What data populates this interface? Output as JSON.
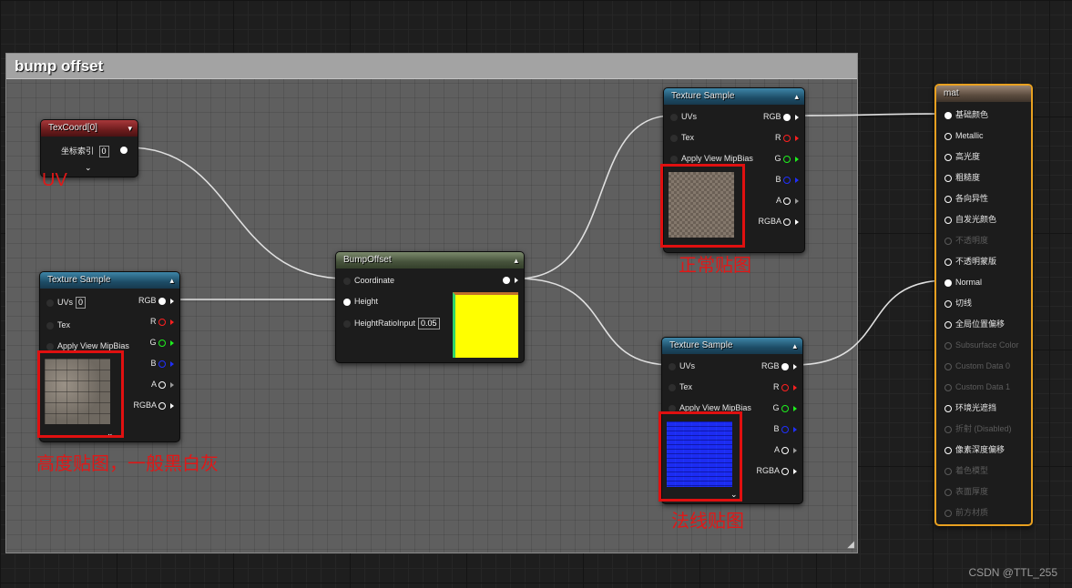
{
  "comment": {
    "title": "bump offset"
  },
  "texcoord_node": {
    "title": "TexCoord[0]",
    "pin_label": "坐标索引",
    "pin_value": "0"
  },
  "texture_height": {
    "title": "Texture Sample",
    "inputs": {
      "uvs": "UVs",
      "uvs_value": "0",
      "tex": "Tex",
      "mip": "Apply View MipBias"
    },
    "outputs": [
      "RGB",
      "R",
      "G",
      "B",
      "A",
      "RGBA"
    ]
  },
  "bump_offset": {
    "title": "BumpOffset",
    "inputs": {
      "coordinate": "Coordinate",
      "height": "Height",
      "ratio": "HeightRatioInput",
      "ratio_value": "0.05"
    }
  },
  "texture_base": {
    "title": "Texture Sample",
    "inputs": {
      "uvs": "UVs",
      "tex": "Tex",
      "mip": "Apply View MipBias"
    },
    "outputs": [
      "RGB",
      "R",
      "G",
      "B",
      "A",
      "RGBA"
    ]
  },
  "texture_normal": {
    "title": "Texture Sample",
    "inputs": {
      "uvs": "UVs",
      "tex": "Tex",
      "mip": "Apply View MipBias"
    },
    "outputs": [
      "RGB",
      "R",
      "G",
      "B",
      "A",
      "RGBA"
    ]
  },
  "material": {
    "title": "mat",
    "pins": [
      {
        "label": "基础颜色",
        "state": "connected"
      },
      {
        "label": "Metallic",
        "state": "open"
      },
      {
        "label": "高光度",
        "state": "open"
      },
      {
        "label": "粗糙度",
        "state": "open"
      },
      {
        "label": "各向异性",
        "state": "open"
      },
      {
        "label": "自发光颜色",
        "state": "open"
      },
      {
        "label": "不透明度",
        "state": "disabled"
      },
      {
        "label": "不透明蒙版",
        "state": "open"
      },
      {
        "label": "Normal",
        "state": "connected"
      },
      {
        "label": "切线",
        "state": "open"
      },
      {
        "label": "全局位置偏移",
        "state": "open"
      },
      {
        "label": "Subsurface Color",
        "state": "disabled"
      },
      {
        "label": "Custom Data 0",
        "state": "disabled"
      },
      {
        "label": "Custom Data 1",
        "state": "disabled"
      },
      {
        "label": "环境光遮挡",
        "state": "open"
      },
      {
        "label": "折射 (Disabled)",
        "state": "disabled"
      },
      {
        "label": "像素深度偏移",
        "state": "open"
      },
      {
        "label": "着色模型",
        "state": "disabled"
      },
      {
        "label": "表面厚度",
        "state": "disabled"
      },
      {
        "label": "前方材质",
        "state": "disabled"
      }
    ]
  },
  "annotations": {
    "uv": "UV",
    "height_map": "高度贴图，一般黑白灰",
    "normal_map_base": "正常贴图",
    "normal_map": "法线贴图"
  },
  "colors": {
    "annotation_red": "#e01010",
    "material_border": "#e8a020",
    "wire": "#e0e0e0"
  },
  "watermark": "CSDN @TTL_255"
}
